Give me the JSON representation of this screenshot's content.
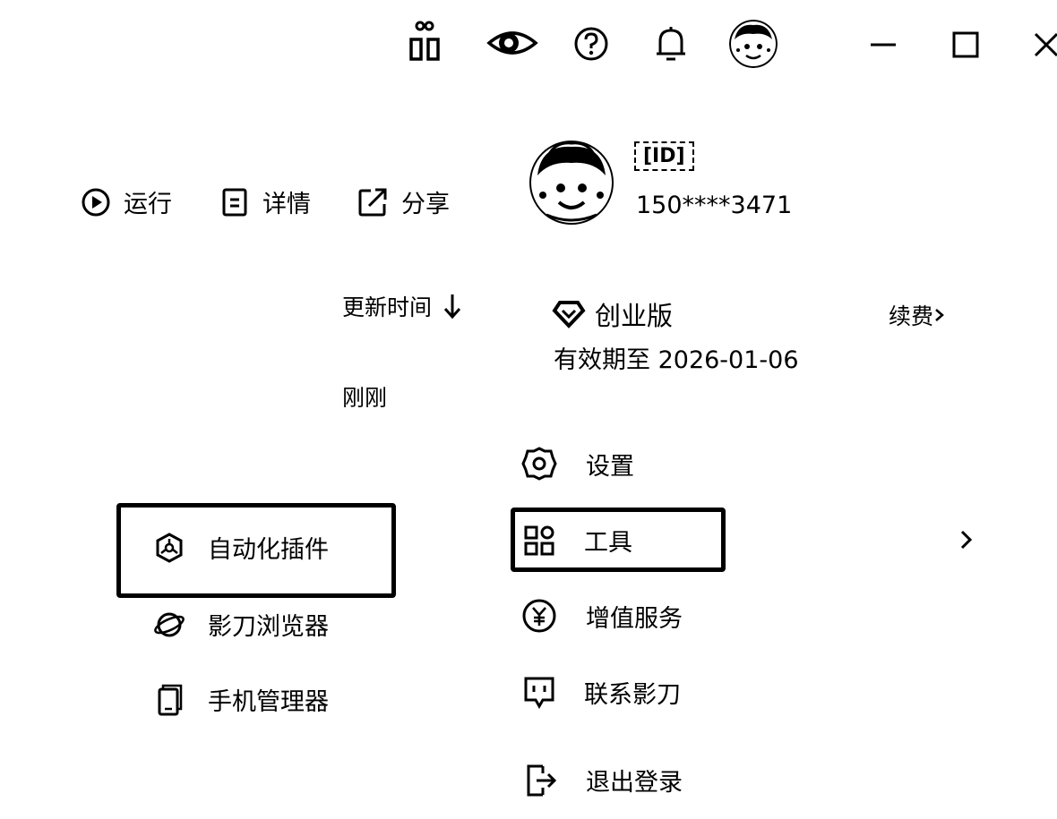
{
  "titlebar": {
    "icons": [
      "gift-icon",
      "eye-icon",
      "help-icon",
      "bell-icon",
      "avatar",
      "minimize-icon",
      "maximize-icon",
      "close-icon"
    ]
  },
  "toolbar": {
    "run_label": "运行",
    "detail_label": "详情",
    "share_label": "分享"
  },
  "list": {
    "sort_label": "更新时间",
    "updated_value": "刚刚"
  },
  "plugins": {
    "items": [
      {
        "label": "自动化插件",
        "icon": "plugin-icon",
        "highlighted": true
      },
      {
        "label": "影刀浏览器",
        "icon": "browser-icon"
      },
      {
        "label": "手机管理器",
        "icon": "phone-icon"
      }
    ]
  },
  "account": {
    "username": "[ID]",
    "phone": "150****3471",
    "plan_name": "创业版",
    "renew_label": "续费",
    "expiry_text": "有效期至 2026-01-06",
    "menu": [
      {
        "label": "设置",
        "icon": "settings-icon"
      },
      {
        "label": "工具",
        "icon": "apps-icon",
        "highlighted": true
      },
      {
        "label": "增值服务",
        "icon": "yen-icon"
      },
      {
        "label": "联系影刀",
        "icon": "chat-icon"
      },
      {
        "label": "退出登录",
        "icon": "logout-icon"
      }
    ]
  }
}
